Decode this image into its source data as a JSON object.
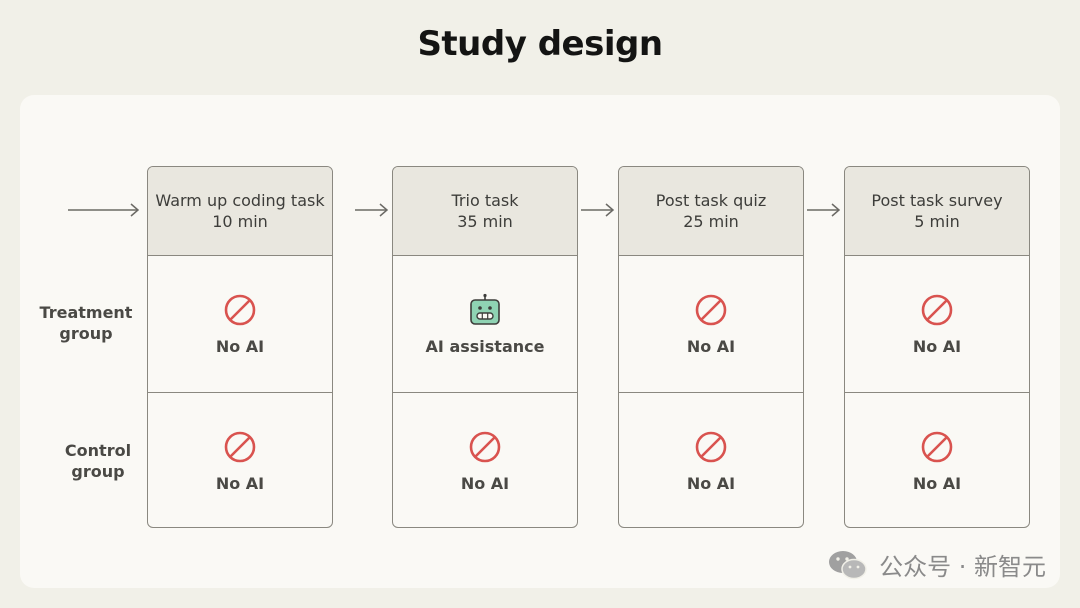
{
  "title": "Study design",
  "row_labels": {
    "treatment": "Treatment\ngroup",
    "control": "Control\ngroup"
  },
  "columns": [
    {
      "name": "Warm up coding task",
      "duration": "10 min",
      "treatment": {
        "icon": "no-ai-icon",
        "label": "No AI"
      },
      "control": {
        "icon": "no-ai-icon",
        "label": "No AI"
      }
    },
    {
      "name": "Trio task",
      "duration": "35 min",
      "treatment": {
        "icon": "robot-icon",
        "label": "AI assistance"
      },
      "control": {
        "icon": "no-ai-icon",
        "label": "No AI"
      }
    },
    {
      "name": "Post task quiz",
      "duration": "25 min",
      "treatment": {
        "icon": "no-ai-icon",
        "label": "No AI"
      },
      "control": {
        "icon": "no-ai-icon",
        "label": "No AI"
      }
    },
    {
      "name": "Post task survey",
      "duration": "5 min",
      "treatment": {
        "icon": "no-ai-icon",
        "label": "No AI"
      },
      "control": {
        "icon": "no-ai-icon",
        "label": "No AI"
      }
    }
  ],
  "watermark": "公众号 · 新智元",
  "colors": {
    "background": "#f1f0e8",
    "panel": "#faf9f5",
    "header": "#e9e7df",
    "no_ai_red": "#d9534f",
    "robot_green": "#8fd3b3"
  }
}
